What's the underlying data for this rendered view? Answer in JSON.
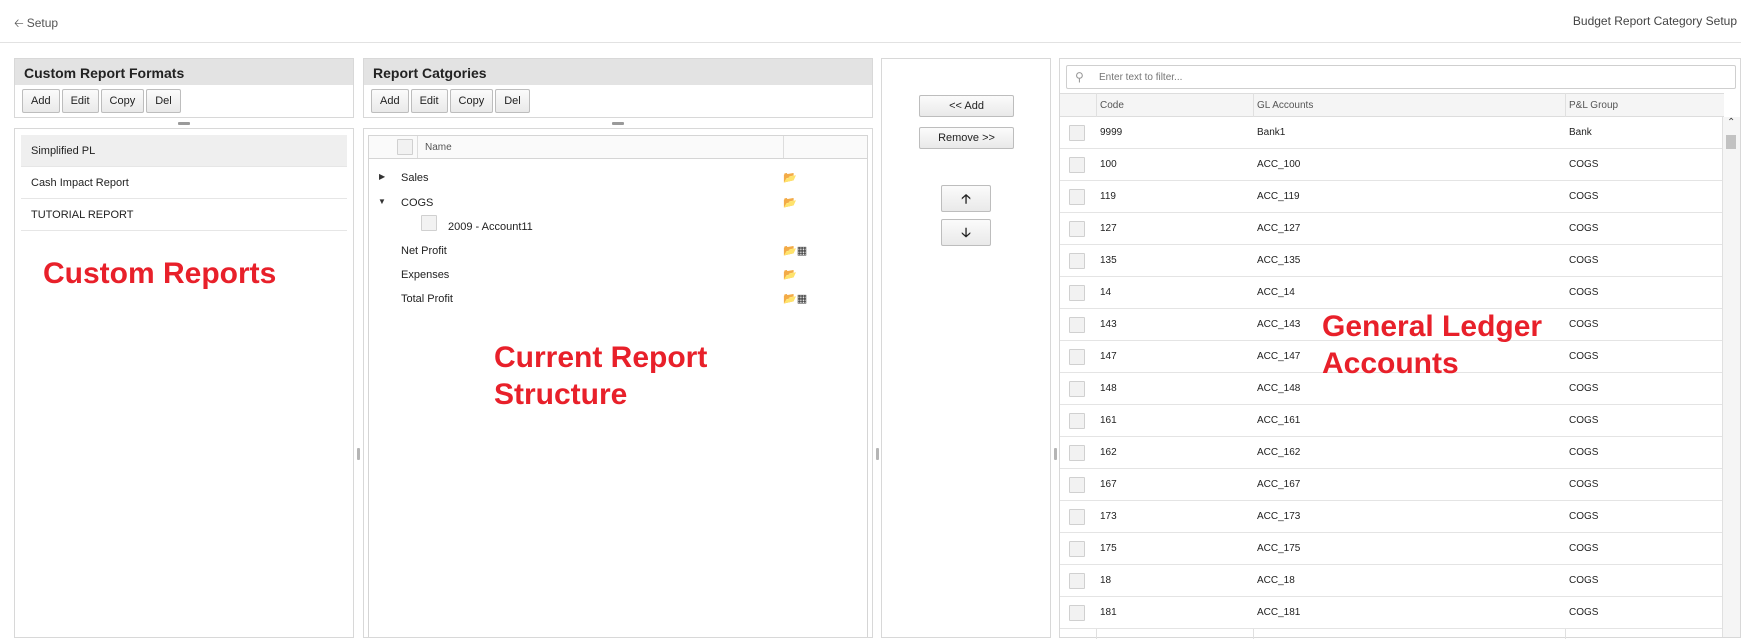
{
  "topbar": {
    "back_label": "Setup",
    "page_title": "Budget Report Category Setup"
  },
  "formats_panel": {
    "title": "Custom Report Formats",
    "buttons": {
      "add": "Add",
      "edit": "Edit",
      "copy": "Copy",
      "del": "Del"
    },
    "items": [
      "Simplified PL",
      "Cash Impact Report",
      "TUTORIAL REPORT"
    ],
    "selected_index": 0
  },
  "categories_panel": {
    "title": "Report Catgories",
    "buttons": {
      "add": "Add",
      "edit": "Edit",
      "copy": "Copy",
      "del": "Del"
    },
    "column_name": "Name",
    "rows": [
      {
        "label": "Sales",
        "expanded": false,
        "icon": "folder-icon"
      },
      {
        "label": "COGS",
        "expanded": true,
        "icon": "folder-icon"
      },
      {
        "label": "2009 - Account11",
        "child": true
      },
      {
        "label": "Net Profit",
        "icon": "folder-calculator-icon"
      },
      {
        "label": "Expenses",
        "icon": "folder-icon"
      },
      {
        "label": "Total Profit",
        "icon": "folder-calculator-icon"
      }
    ]
  },
  "transfer": {
    "add_label": "<< Add",
    "remove_label": "Remove >>",
    "up_icon": "arrow-up-icon",
    "down_icon": "arrow-down-icon"
  },
  "gl_panel": {
    "filter_placeholder": "Enter text to filter...",
    "columns": {
      "code": "Code",
      "gl": "GL Accounts",
      "pl": "P&L Group"
    },
    "rows": [
      {
        "code": "9999",
        "gl": "Bank1",
        "pl": "Bank"
      },
      {
        "code": "100",
        "gl": "ACC_100",
        "pl": "COGS"
      },
      {
        "code": "119",
        "gl": "ACC_119",
        "pl": "COGS"
      },
      {
        "code": "127",
        "gl": "ACC_127",
        "pl": "COGS"
      },
      {
        "code": "135",
        "gl": "ACC_135",
        "pl": "COGS"
      },
      {
        "code": "14",
        "gl": "ACC_14",
        "pl": "COGS"
      },
      {
        "code": "143",
        "gl": "ACC_143",
        "pl": "COGS"
      },
      {
        "code": "147",
        "gl": "ACC_147",
        "pl": "COGS"
      },
      {
        "code": "148",
        "gl": "ACC_148",
        "pl": "COGS"
      },
      {
        "code": "161",
        "gl": "ACC_161",
        "pl": "COGS"
      },
      {
        "code": "162",
        "gl": "ACC_162",
        "pl": "COGS"
      },
      {
        "code": "167",
        "gl": "ACC_167",
        "pl": "COGS"
      },
      {
        "code": "173",
        "gl": "ACC_173",
        "pl": "COGS"
      },
      {
        "code": "175",
        "gl": "ACC_175",
        "pl": "COGS"
      },
      {
        "code": "18",
        "gl": "ACC_18",
        "pl": "COGS"
      },
      {
        "code": "181",
        "gl": "ACC_181",
        "pl": "COGS"
      }
    ]
  },
  "annotations": {
    "custom_reports": "Custom Reports",
    "current_structure": "Current Report\nStructure",
    "gl_accounts": "General Ledger\nAccounts"
  },
  "colors": {
    "annotation": "#e8202a",
    "header_bg": "#e3e3e3"
  }
}
